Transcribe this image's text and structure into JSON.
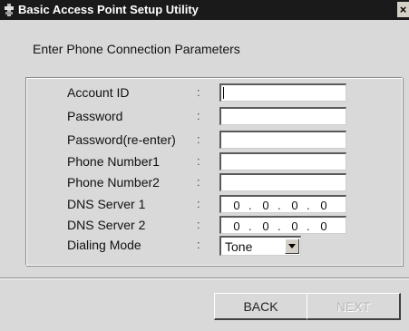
{
  "window": {
    "title": "Basic Access Point Setup Utility",
    "close_glyph": "×"
  },
  "page": {
    "prompt": "Enter Phone Connection Parameters"
  },
  "form": {
    "separator": ":",
    "fields": [
      {
        "label": "Account ID",
        "value": ""
      },
      {
        "label": "Password",
        "value": ""
      },
      {
        "label": "Password(re-enter)",
        "value": ""
      },
      {
        "label": "Phone Number1",
        "value": ""
      },
      {
        "label": "Phone Number2",
        "value": ""
      }
    ],
    "dns1": {
      "label": "DNS Server 1",
      "octets": [
        "0",
        "0",
        "0",
        "0"
      ]
    },
    "dns2": {
      "label": "DNS Server 2",
      "octets": [
        "0",
        "0",
        "0",
        "0"
      ]
    },
    "dialing_mode": {
      "label": "Dialing Mode",
      "value": "Tone"
    }
  },
  "buttons": {
    "back": "BACK",
    "next": "NEXT"
  },
  "icons": {
    "title": "network-plug-icon",
    "dropdown": "chevron-down-icon"
  },
  "colors": {
    "titlebar": "#1a1a1a",
    "window": "#d9d9d9",
    "disabled_text": "#b8b8b8"
  }
}
